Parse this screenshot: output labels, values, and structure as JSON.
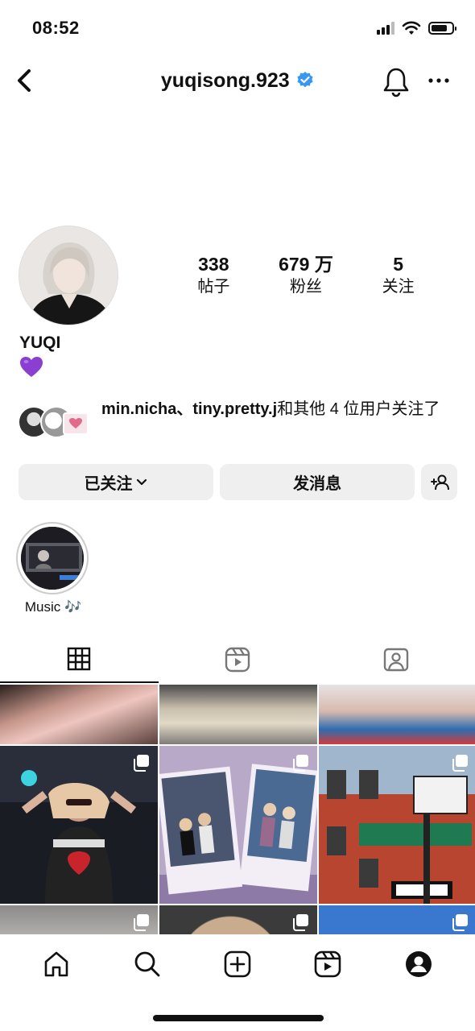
{
  "status_bar": {
    "time": "08:52",
    "signal_icon": "cellular-signal-icon",
    "wifi_icon": "wifi-icon",
    "battery_icon": "battery-icon"
  },
  "header": {
    "username": "yuqisong.923",
    "verified_icon": "verified-badge-icon",
    "back_icon": "chevron-left-icon",
    "bell_icon": "bell-icon",
    "more_icon": "more-horizontal-icon"
  },
  "profile": {
    "stats": [
      {
        "value": "338",
        "label": "帖子"
      },
      {
        "value": "679 万",
        "label": "粉丝"
      },
      {
        "value": "5",
        "label": "关注"
      }
    ],
    "display_name": "YUQI",
    "bio_emoji": "purple-heart-icon"
  },
  "followed_by": {
    "names": "min.nicha、tiny.pretty.j",
    "rest": "和其他 4 位用户关注了"
  },
  "actions": {
    "following": "已关注",
    "message": "发消息",
    "add_user_icon": "add-user-icon"
  },
  "highlights": [
    {
      "label": "Music 🎶"
    }
  ],
  "tabs": [
    {
      "icon": "grid-icon",
      "active": true
    },
    {
      "icon": "reels-icon",
      "active": false
    },
    {
      "icon": "tagged-icon",
      "active": false
    }
  ],
  "bottom_nav": [
    "home-icon",
    "search-icon",
    "create-icon",
    "reels-icon",
    "profile-icon"
  ],
  "colors": {
    "verified": "#3897f0",
    "button_bg": "#efefef",
    "heart": "#8a3fd1"
  }
}
